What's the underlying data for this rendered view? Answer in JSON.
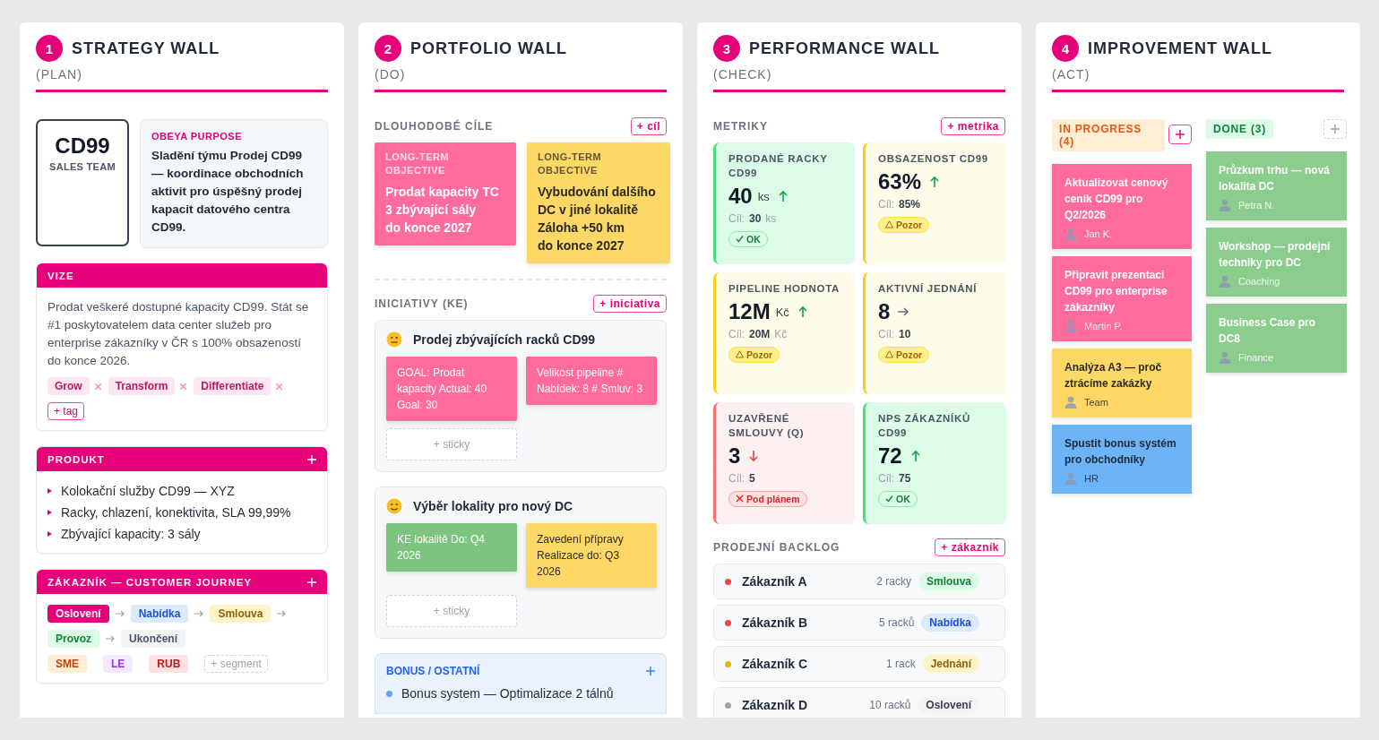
{
  "strategy_wall": {
    "header": {
      "number": "1",
      "title": "STRATEGY WALL",
      "subtitle": "(PLAN)"
    },
    "identity": {
      "code": "CD99",
      "team": "SALES TEAM"
    },
    "purpose": {
      "label": "OBEYA PURPOSE",
      "text": "Sladění týmu Prodej CD99 — koordinace obchodních aktivit pro úspěšný prodej kapacit datového centra CD99."
    },
    "vision": {
      "title": "VIZE",
      "text": "Prodat veškeré dostupné kapacity CD99. Stát se #1 poskytovatelem data center služeb pro enterprise zákazníky v ČR s 100% obsazeností do konce 2026.",
      "tags": [
        "Grow",
        "Transform",
        "Differentiate"
      ],
      "add_tag": "+ tag"
    },
    "product": {
      "title": "PRODUKT",
      "items": [
        "Kolokační služby CD99 — XYZ",
        "Racky, chlazení, konektivita, SLA 99,99%",
        "Zbývající kapacity: 3 sály"
      ]
    },
    "journey": {
      "title": "ZÁKAZNÍK — CUSTOMER JOURNEY",
      "steps": [
        {
          "label": "Oslovení",
          "kind": "pink"
        },
        {
          "label": "Nabídka",
          "kind": "blue"
        },
        {
          "label": "Smlouva",
          "kind": "yellow"
        },
        {
          "label": "Provoz",
          "kind": "green"
        },
        {
          "label": "Ukončení",
          "kind": "gray"
        }
      ],
      "segments": [
        {
          "label": "SME",
          "kind": "orange"
        },
        {
          "label": "LE",
          "kind": "purple"
        },
        {
          "label": "RUB",
          "kind": "red"
        }
      ],
      "add_segment": "+ segment"
    }
  },
  "portfolio_wall": {
    "header": {
      "number": "2",
      "title": "PORTFOLIO WALL",
      "subtitle": "(DO)"
    },
    "goals": {
      "title": "DLOUHODOBÉ CÍLE",
      "add": "+ cíl",
      "items": [
        {
          "label": "LONG-TERM OBJECTIVE",
          "text": "Prodat kapacity TC\n3 zbývající sály\ndo konce 2027",
          "kind": "pink"
        },
        {
          "label": "LONG-TERM OBJECTIVE",
          "text": "Vybudování dalšího\nDC v jiné lokalitě\nZáloha +50 km\ndo konce 2027",
          "kind": "yellow"
        }
      ]
    },
    "initiatives": {
      "title": "INICIATIVY (KE)",
      "add": "+ iniciativa",
      "items": [
        {
          "kind": "neutral",
          "title": "Prodej zbývajících racků CD99",
          "add_sticky": "+ sticky",
          "stickies": [
            {
              "text": "GOAL: Prodat kapacity Actual: 40 Goal: 30",
              "kind": "pink"
            },
            {
              "text": "Velikost pipeline # Nabídek: 8 # Smluv: 3",
              "kind": "pink"
            }
          ]
        },
        {
          "kind": "smile",
          "title": "Výběr lokality pro nový DC",
          "add_sticky": "+ sticky",
          "stickies": [
            {
              "text": "KE lokalitě Do: Q4 2026",
              "kind": "green"
            },
            {
              "text": "Zavedení přípravy Realizace do: Q3 2026",
              "kind": "yellow"
            }
          ]
        }
      ]
    },
    "bonus": {
      "title": "BONUS / OSTATNÍ",
      "items": [
        "Bonus system — Optimalizace 2 tálnů"
      ]
    }
  },
  "performance_wall": {
    "header": {
      "number": "3",
      "title": "PERFORMANCE WALL",
      "subtitle": "(CHECK)"
    },
    "metrics": {
      "title": "METRIKY",
      "add": "+ metrika",
      "items": [
        {
          "title": "PRODANÉ RACKY CD99",
          "value": "40",
          "unit": "ks",
          "trend": {
            "kind": "up"
          },
          "target_label": "Cíl:",
          "target": "30",
          "target_unit": "ks",
          "status": {
            "kind": "ok",
            "label": "OK"
          }
        },
        {
          "title": "OBSAZENOST CD99",
          "value": "63%",
          "trend": {
            "kind": "up"
          },
          "target_label": "Cíl:",
          "target": "85%",
          "status": {
            "kind": "warn",
            "label": "Pozor"
          }
        },
        {
          "title": "PIPELINE HODNOTA",
          "value": "12M",
          "unit": "Kč",
          "trend": {
            "kind": "up"
          },
          "target_label": "Cíl:",
          "target": "20M",
          "target_unit": "Kč",
          "status": {
            "kind": "warn",
            "label": "Pozor"
          }
        },
        {
          "title": "AKTIVNÍ JEDNÁNÍ",
          "value": "8",
          "trend": {
            "kind": "flat"
          },
          "target_label": "Cíl:",
          "target": "10",
          "status": {
            "kind": "warn",
            "label": "Pozor"
          }
        },
        {
          "title": "UZAVŘENÉ SMLOUVY (Q)",
          "value": "3",
          "trend": {
            "kind": "down"
          },
          "target_label": "Cíl:",
          "target": "5",
          "status": {
            "kind": "bad",
            "label": "Pod plánem"
          }
        },
        {
          "title": "NPS ZÁKAZNÍKŮ CD99",
          "value": "72",
          "trend": {
            "kind": "up"
          },
          "target_label": "Cíl:",
          "target": "75",
          "status": {
            "kind": "ok",
            "label": "OK"
          }
        }
      ]
    },
    "backlog": {
      "title": "PRODEJNÍ BACKLOG",
      "add": "+ zákazník",
      "items": [
        {
          "name": "Zákazník A",
          "color": "#ef4444",
          "count": "2 racky",
          "stage": {
            "label": "Smlouva",
            "kind": "green"
          }
        },
        {
          "name": "Zákazník B",
          "color": "#ef4444",
          "count": "5 racků",
          "stage": {
            "label": "Nabídka",
            "kind": "blue"
          }
        },
        {
          "name": "Zákazník C",
          "color": "#eab308",
          "count": "1 rack",
          "stage": {
            "label": "Jednání",
            "kind": "yellow"
          }
        },
        {
          "name": "Zákazník D",
          "color": "#9ca3af",
          "count": "10 racků",
          "stage": {
            "label": "Oslovení",
            "kind": "gray"
          }
        }
      ]
    }
  },
  "improvement_wall": {
    "header": {
      "number": "4",
      "title": "IMPROVEMENT WALL",
      "subtitle": "(ACT)"
    },
    "columns": [
      {
        "title": "IN PROGRESS (4)",
        "kind": "progress",
        "cards": [
          {
            "text": "Aktualizovat cenový ceník CD99 pro Q2/2026",
            "owner": "Jan K.",
            "kind": "pink"
          },
          {
            "text": "Připravit prezentaci CD99 pro enterprise zákazníky",
            "owner": "Martin P.",
            "kind": "pink"
          },
          {
            "text": "Analýza A3 — proč ztrácíme zakázky",
            "owner": "Team",
            "kind": "yellow"
          },
          {
            "text": "Spustit bonus systém pro obchodníky",
            "owner": "HR",
            "kind": "blue"
          }
        ]
      },
      {
        "title": "DONE (3)",
        "kind": "done",
        "cards": [
          {
            "text": "Průzkum trhu — nová lokalita DC",
            "owner": "Petra N.",
            "kind": "green"
          },
          {
            "text": "Workshop — prodejní techniky pro DC",
            "owner": "Coaching",
            "kind": "green"
          },
          {
            "text": "Business Case pro DC8",
            "owner": "Finance",
            "kind": "green"
          }
        ]
      }
    ]
  }
}
